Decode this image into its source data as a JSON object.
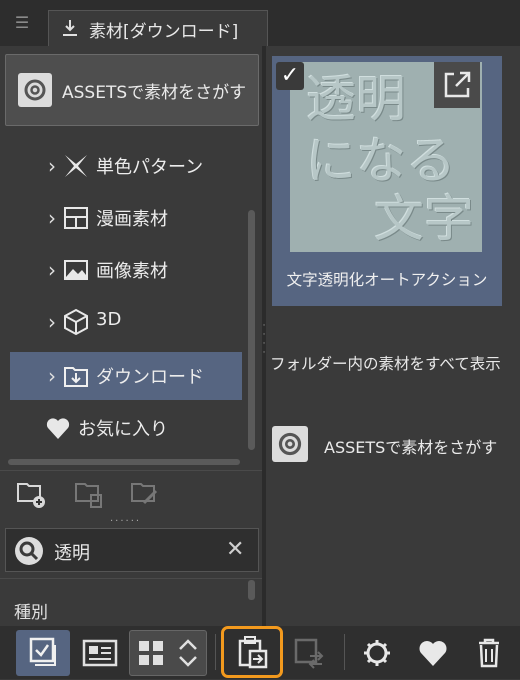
{
  "tab": {
    "menu_icon": "hamburger-icon",
    "icon": "download-icon",
    "label": "素材[ダウンロード]"
  },
  "assets_top": {
    "label": "ASSETSで素材をさがす",
    "icon": "assets-logo-icon"
  },
  "tree": [
    {
      "label": "単色パターン",
      "icon": "pattern-icon",
      "selected": false
    },
    {
      "label": "漫画素材",
      "icon": "manga-icon",
      "selected": false
    },
    {
      "label": "画像素材",
      "icon": "image-icon",
      "selected": false
    },
    {
      "label": "3D",
      "icon": "cube-icon",
      "selected": false
    },
    {
      "label": "ダウンロード",
      "icon": "download-folder-icon",
      "selected": true
    },
    {
      "label": "お気に入り",
      "icon": "heart-icon",
      "selected": false
    }
  ],
  "search": {
    "value": "透明"
  },
  "filter": {
    "label": "種別"
  },
  "material": {
    "thumb_lines": [
      "透明",
      "になる",
      "文字"
    ],
    "title": "文字透明化オートアクション",
    "checked": true
  },
  "show_all": "フォルダー内の素材をすべて表示",
  "assets_bottom": {
    "label": "ASSETSで素材をさがす"
  },
  "colors": {
    "selected": "#566581",
    "highlight": "#f39a1e",
    "panel": "#3a3a3a"
  }
}
